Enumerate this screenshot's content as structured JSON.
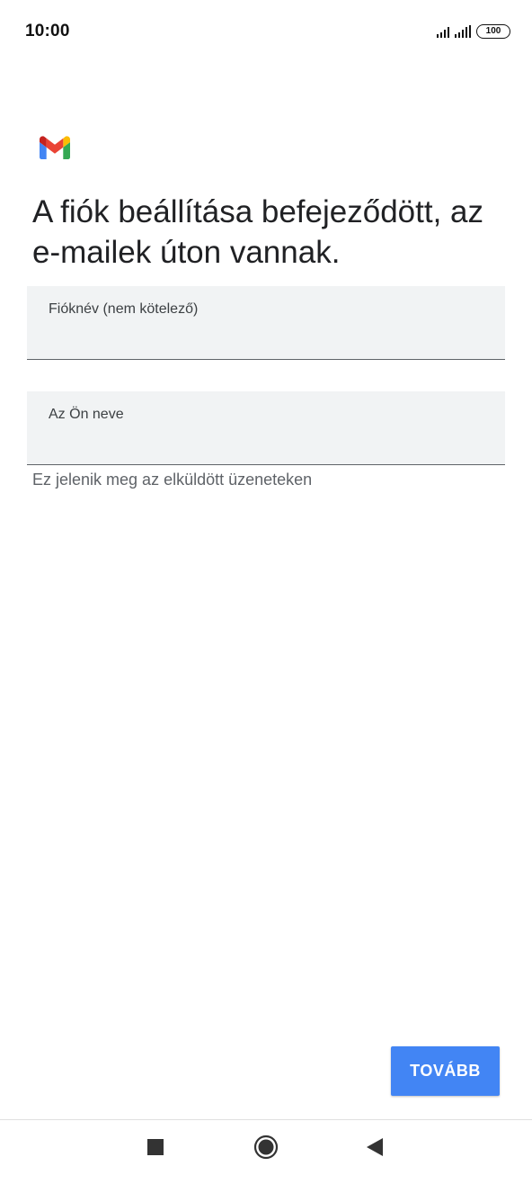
{
  "status_bar": {
    "time": "10:00",
    "battery": "100",
    "icons": [
      "signal-icon",
      "signal-icon",
      "battery-icon"
    ]
  },
  "logo": {
    "icon": "gmail-logo",
    "colors": [
      "#4285f4",
      "#34a853",
      "#fbbc04",
      "#ea4335",
      "#c5221f"
    ]
  },
  "headline": "A fiók beállítása befejeződött, az e-mailek úton vannak.",
  "fields": {
    "account_name": {
      "label": "Fióknév (nem kötelező)",
      "value": ""
    },
    "your_name": {
      "label": "Az Ön neve",
      "value": "",
      "helper": "Ez jelenik meg az elküldött üzeneteken"
    }
  },
  "next_button": {
    "label": "TOVÁBB",
    "color": "#4285f4"
  },
  "nav_bar": {
    "items": [
      "recents-icon",
      "home-icon",
      "back-icon"
    ]
  }
}
